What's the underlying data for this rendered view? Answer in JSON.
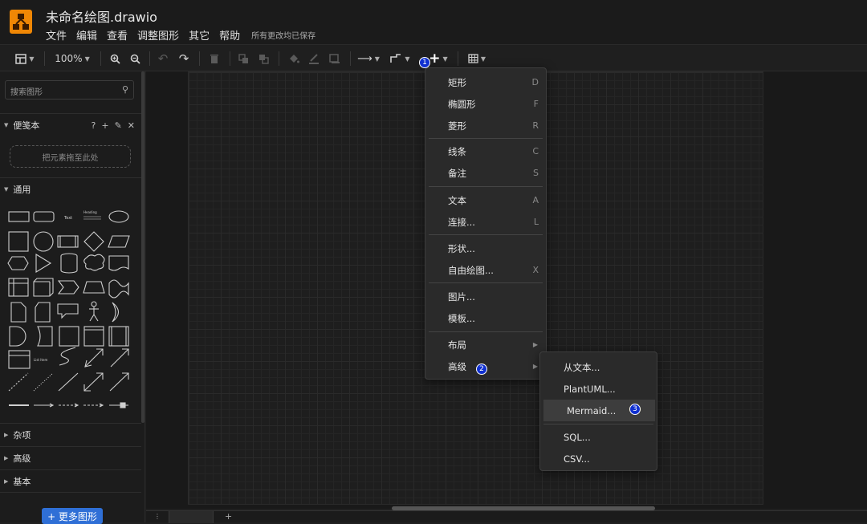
{
  "app": {
    "title": "未命名绘图.drawio",
    "menus": [
      "文件",
      "编辑",
      "查看",
      "调整图形",
      "其它",
      "帮助"
    ],
    "save_status": "所有更改均已保存"
  },
  "toolbar": {
    "zoom": "100%",
    "icons": [
      "format-panel-icon",
      "zoom-in-icon",
      "zoom-out-icon",
      "undo-icon",
      "redo-icon",
      "delete-icon",
      "to-front-icon",
      "to-back-icon",
      "fill-color-icon",
      "line-color-icon",
      "shadow-icon",
      "connection-icon",
      "waypoints-icon",
      "insert-plus-icon",
      "table-icon"
    ]
  },
  "sidebar": {
    "search_placeholder": "搜索图形",
    "scratchpad": {
      "title": "便笺本",
      "dropzone": "把元素拖至此处"
    },
    "general": {
      "title": "通用"
    },
    "sections": [
      "杂项",
      "高级",
      "基本"
    ],
    "more_shapes": "+ 更多图形"
  },
  "insert_menu": {
    "groups": [
      [
        {
          "label": "矩形",
          "shortcut": "D"
        },
        {
          "label": "椭圆形",
          "shortcut": "F"
        },
        {
          "label": "菱形",
          "shortcut": "R"
        }
      ],
      [
        {
          "label": "线条",
          "shortcut": "C"
        },
        {
          "label": "备注",
          "shortcut": "S"
        }
      ],
      [
        {
          "label": "文本",
          "shortcut": "A"
        },
        {
          "label": "连接...",
          "shortcut": "L"
        }
      ],
      [
        {
          "label": "形状...",
          "shortcut": ""
        },
        {
          "label": "自由绘图...",
          "shortcut": "X"
        }
      ],
      [
        {
          "label": "图片...",
          "shortcut": ""
        },
        {
          "label": "模板...",
          "shortcut": ""
        }
      ],
      [
        {
          "label": "布局",
          "shortcut": "",
          "submenu": true
        },
        {
          "label": "高级",
          "shortcut": "",
          "submenu": true
        }
      ]
    ]
  },
  "advanced_submenu": {
    "items": [
      "从文本...",
      "PlantUML...",
      "Mermaid...",
      "SQL...",
      "CSV..."
    ],
    "highlighted": "Mermaid..."
  },
  "annotations": [
    "1",
    "2",
    "3"
  ],
  "colors": {
    "accent": "#2f6fd6",
    "logo": "#f08705",
    "badge": "#1030d0",
    "canvas": "#1e1e1e"
  }
}
